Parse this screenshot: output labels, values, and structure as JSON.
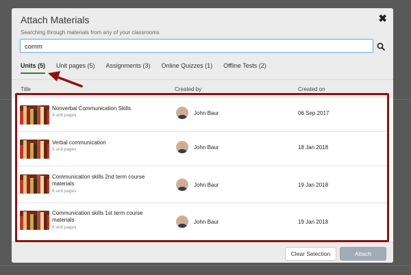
{
  "modal": {
    "title": "Attach Materials",
    "close_glyph": "✖",
    "subtitle": "Searching through materials from any of your classrooms"
  },
  "search": {
    "value": "comm",
    "icon": "search-icon"
  },
  "tabs": [
    {
      "label": "Units (5)",
      "active": true
    },
    {
      "label": "Unit pages (5)",
      "active": false
    },
    {
      "label": "Assignments (3)",
      "active": false
    },
    {
      "label": "Online Quizzes (1)",
      "active": false
    },
    {
      "label": "Offline Tests (2)",
      "active": false
    }
  ],
  "columns": {
    "title": "Title",
    "created_by": "Created by",
    "created_on": "Created on"
  },
  "rows": [
    {
      "title": "Nonverbal Communication Skills",
      "subtitle": "4 unit pages",
      "author": "John Baur",
      "date": "06 Sep 2017"
    },
    {
      "title": "Verbal communication",
      "subtitle": "5 unit pages",
      "author": "John Baur",
      "date": "18 Jan 2018"
    },
    {
      "title": "Communication skills 2nd term course materials",
      "subtitle": "6 unit pages",
      "author": "John Baur",
      "date": "19 Jan 2018"
    },
    {
      "title": "Communication skills 1st term course materials",
      "subtitle": "6 unit pages",
      "author": "John Baur",
      "date": "19 Jan 2018"
    }
  ],
  "footer": {
    "clear_label": "Clear Selection",
    "attach_label": "Attach"
  },
  "colors": {
    "highlight": "#8b1111",
    "active_tab_underline": "#2e7d3a",
    "attach_button": "#a3acb6"
  }
}
